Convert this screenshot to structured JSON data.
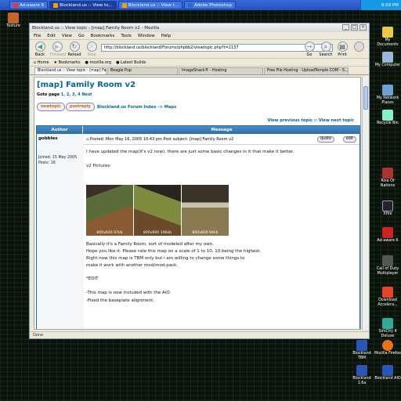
{
  "taskbar": {
    "tasks": [
      {
        "label": "Ad-aware 6",
        "icon": "ad-aware-icon"
      },
      {
        "label": "Blockland.us :: View to...",
        "icon": "firefox-icon",
        "active": true
      },
      {
        "label": "Blockland.us :: View t...",
        "icon": "firefox-icon"
      },
      {
        "label": "Adobe Photoshop",
        "icon": "photoshop-icon"
      }
    ],
    "clock": "8:59 PM"
  },
  "desktop": {
    "left_icons": [
      {
        "label": "Texture"
      }
    ],
    "right_icons": [
      {
        "label": "My Documents"
      },
      {
        "label": "My Computer"
      },
      {
        "label": "My Network Places"
      },
      {
        "label": "Recycle Bin"
      },
      {
        "label": "Rise Of Nations"
      },
      {
        "label": "Xfire"
      },
      {
        "label": "Ad-aware 6"
      },
      {
        "label": "Call of Duty Multiplayer"
      },
      {
        "label": "Download Accelera..."
      },
      {
        "label": "SimCity 4 Deluxe"
      }
    ],
    "bottom_icons": [
      {
        "label": "Blockland TBM"
      },
      {
        "label": "Mozilla Firefox"
      },
      {
        "label": "Blockland 1.6a"
      },
      {
        "label": "Blockland AIO"
      }
    ]
  },
  "window": {
    "title": "Blockland.us :: View topic - [map] Family Room v2 - Mozilla",
    "menu": [
      "File",
      "Edit",
      "View",
      "Go",
      "Bookmarks",
      "Tools",
      "Window",
      "Help"
    ],
    "nav": {
      "back": "Back",
      "forward": "Forward",
      "reload": "Reload",
      "stop": "Stop",
      "go": "Go",
      "search": "Search",
      "print": "Print"
    },
    "url": "http://blockland.us/blockland/Forums/phpbb2/viewtopic.php?t=2137",
    "bookmarks": [
      "Home",
      "Bookmarks",
      "mozilla.org",
      "Latest Builds"
    ],
    "tabs": [
      "Blockland.us :: View topic - [map] Family R...",
      "Beagle Pup",
      "ImageShack® - Hosting",
      "Free File Hosting - UploadTemple.COM - S..."
    ],
    "status": "Done"
  },
  "page": {
    "title": "[map] Family Room v2",
    "goto_label": "Goto page",
    "goto_pages": "1, 2, 3, 4",
    "goto_next": "Next",
    "newtopic": "newtopic",
    "postreply": "postreply",
    "breadcrumb": "Blockland.us Forum Index -> Maps",
    "prev_next": "View previous topic :: View next topic",
    "col_author": "Author",
    "col_message": "Message",
    "author": "gobbles",
    "joined": "Joined: 15 May 2005",
    "posts": "Posts: 16",
    "posted": "Posted: Mon May 16, 2005 10:43 pm    Post subject: [map] Family Room v2",
    "quote": "quote",
    "edit": "edit",
    "body_lines": [
      "I have updated the map(it's v2 now). there are just some basic changes in it that make it better.",
      "v2 Pictures-",
      "Basically it's a Family Room, sort of modeled after my own.",
      "Hope you like it. Please rate this map on a scale of 1 to 10, 10 being the highest.",
      "Right now this map is TBM only but i am willing to change some things to",
      "make it work with another mod/mod-pack.",
      "*EDIT",
      "-This map is now included with the AiO.",
      "-Fixed the baseplate alignment."
    ],
    "shots": [
      {
        "label": "800x600 97kb"
      },
      {
        "label": "800x600 106kb"
      },
      {
        "label": "800x600 94kb"
      }
    ]
  }
}
